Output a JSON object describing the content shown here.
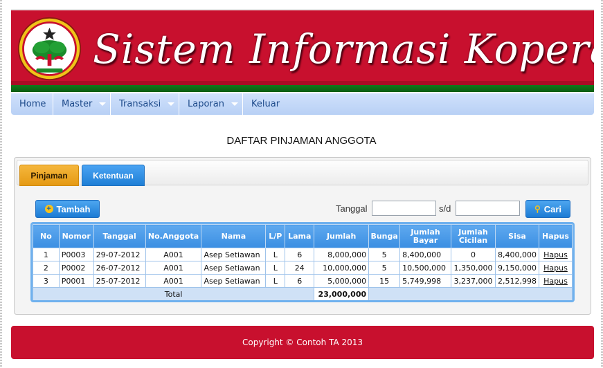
{
  "header": {
    "title": "Sistem Informasi Koperasi",
    "colors": {
      "brand": "#c8102e",
      "accent_green": "#0e7a1a"
    }
  },
  "nav": {
    "items": [
      {
        "label": "Home",
        "has_dropdown": false
      },
      {
        "label": "Master",
        "has_dropdown": true
      },
      {
        "label": "Transaksi",
        "has_dropdown": true
      },
      {
        "label": "Laporan",
        "has_dropdown": true
      },
      {
        "label": "Keluar",
        "has_dropdown": false
      }
    ]
  },
  "page": {
    "title": "DAFTAR PINJAMAN ANGGOTA"
  },
  "tabs": [
    {
      "label": "Pinjaman",
      "active": true
    },
    {
      "label": "Ketentuan",
      "active": false
    }
  ],
  "toolbar": {
    "tambah_label": "Tambah",
    "tanggal_label": "Tanggal",
    "sd_label": "s/d",
    "date_from": "",
    "date_to": "",
    "cari_label": "Cari",
    "plus_icon": "plus-circle-icon",
    "search_icon": "search-icon"
  },
  "table": {
    "headers": [
      "No",
      "Nomor",
      "Tanggal",
      "No.Anggota",
      "Nama",
      "L/P",
      "Lama",
      "Jumlah",
      "Bunga",
      "Jumlah Bayar",
      "Jumlah Cicilan",
      "Sisa",
      "Hapus"
    ],
    "rows": [
      [
        "1",
        "P0003",
        "29-07-2012",
        "A001",
        "Asep Setiawan",
        "L",
        "6",
        "8,000,000",
        "5",
        "8,400,000",
        "0",
        "8,400,000",
        "Hapus"
      ],
      [
        "2",
        "P0002",
        "26-07-2012",
        "A001",
        "Asep Setiawan",
        "L",
        "24",
        "10,000,000",
        "5",
        "10,500,000",
        "1,350,000",
        "9,150,000",
        "Hapus"
      ],
      [
        "3",
        "P0001",
        "25-07-2012",
        "A001",
        "Asep Setiawan",
        "L",
        "6",
        "5,000,000",
        "15",
        "5,749,998",
        "3,237,000",
        "2,512,998",
        "Hapus"
      ]
    ],
    "total_label": "Total",
    "total_value": "23,000,000"
  },
  "footer": {
    "text": "Copyright © Contoh TA 2013"
  }
}
